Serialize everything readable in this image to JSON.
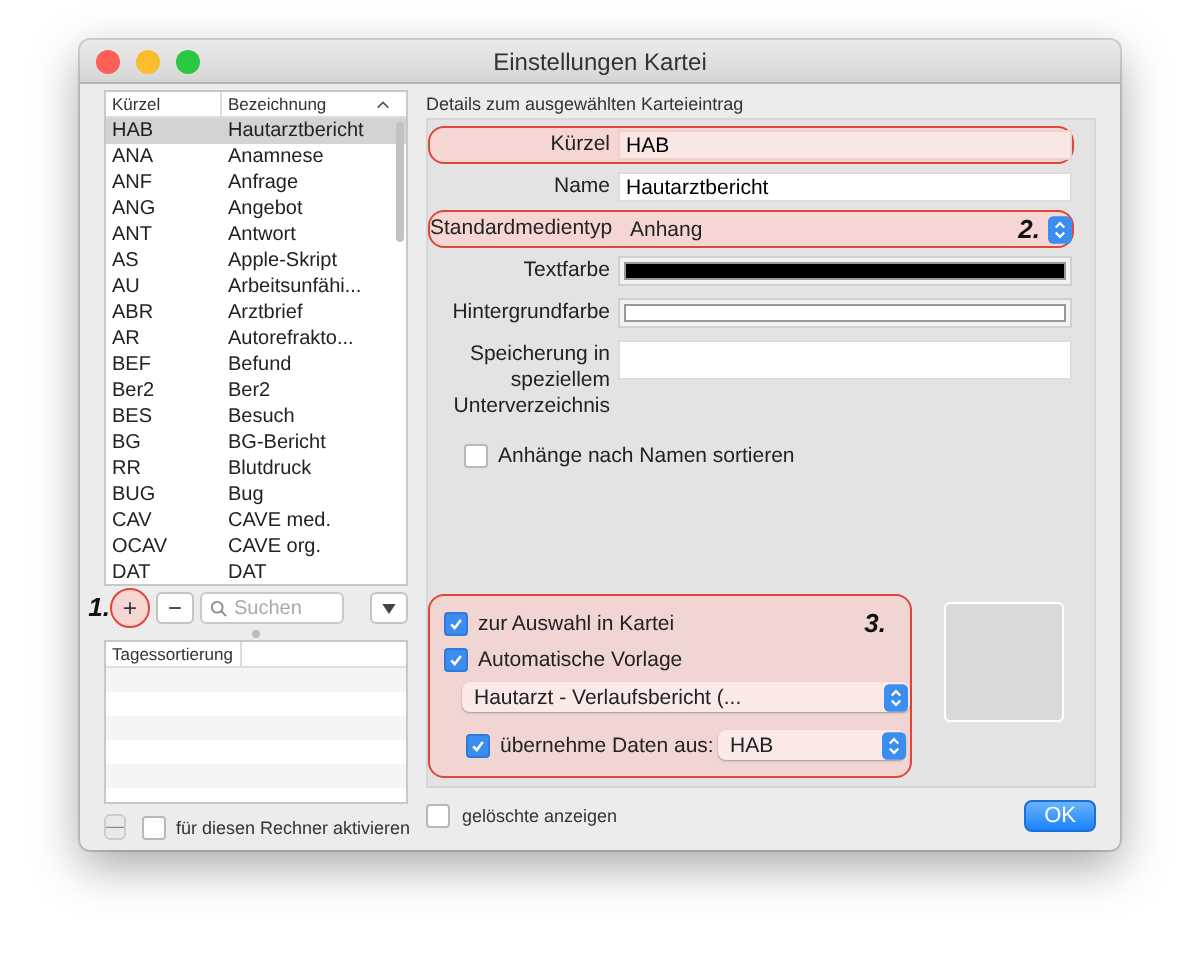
{
  "window": {
    "title": "Einstellungen Kartei"
  },
  "list": {
    "columns": [
      "Kürzel",
      "Bezeichnung"
    ],
    "rows": [
      {
        "code": "HAB",
        "name": "Hautarztbericht",
        "selected": true
      },
      {
        "code": "ANA",
        "name": "Anamnese",
        "selected": false
      },
      {
        "code": "ANF",
        "name": "Anfrage",
        "selected": false
      },
      {
        "code": "ANG",
        "name": "Angebot",
        "selected": false
      },
      {
        "code": "ANT",
        "name": "Antwort",
        "selected": false
      },
      {
        "code": "AS",
        "name": "Apple-Skript",
        "selected": false
      },
      {
        "code": "AU",
        "name": "Arbeitsunfähi...",
        "selected": false
      },
      {
        "code": "ABR",
        "name": "Arztbrief",
        "selected": false
      },
      {
        "code": "AR",
        "name": "Autorefrakto...",
        "selected": false
      },
      {
        "code": "BEF",
        "name": "Befund",
        "selected": false
      },
      {
        "code": "Ber2",
        "name": "Ber2",
        "selected": false
      },
      {
        "code": "BES",
        "name": "Besuch",
        "selected": false
      },
      {
        "code": "BG",
        "name": "BG-Bericht",
        "selected": false
      },
      {
        "code": "RR",
        "name": "Blutdruck",
        "selected": false
      },
      {
        "code": "BUG",
        "name": "Bug",
        "selected": false
      },
      {
        "code": "CAV",
        "name": "CAVE med.",
        "selected": false
      },
      {
        "code": "OCAV",
        "name": "CAVE org.",
        "selected": false
      },
      {
        "code": "DAT",
        "name": "DAT",
        "selected": false
      }
    ]
  },
  "toolbar": {
    "add": {
      "label": "+",
      "highlighted": true,
      "annotation": "1."
    },
    "remove": {
      "label": "−"
    },
    "search": {
      "placeholder": "Suchen"
    }
  },
  "day_sort": {
    "columns": [
      "Tagessortierung"
    ]
  },
  "machine": {
    "remove": {
      "label": "—",
      "disabled": true
    },
    "activate": {
      "label": "für diesen Rechner aktivieren",
      "checked": false
    }
  },
  "details": {
    "heading": "Details zum ausgewählten Karteieintrag",
    "fields": [
      {
        "kind": "text",
        "label": "Kürzel",
        "value": "HAB",
        "highlighted": true
      },
      {
        "kind": "text",
        "label": "Name",
        "value": "Hautarztbericht",
        "highlighted": false
      },
      {
        "kind": "select",
        "label": "Standardmedientyp",
        "value": "Anhang",
        "highlighted": true,
        "annotation": "2."
      },
      {
        "kind": "color",
        "label": "Textfarbe",
        "color": "#000000",
        "highlighted": false
      },
      {
        "kind": "color",
        "label": "Hintergrundfarbe",
        "color": "#ffffff",
        "highlighted": false
      },
      {
        "kind": "text",
        "label": "Speicherung in speziellem Unterverzeichnis",
        "highlighted": false
      }
    ],
    "sort_attachments": {
      "label": "Anhänge nach Namen sortieren",
      "checked": false
    }
  },
  "options": {
    "highlighted": true,
    "annotation": "3.",
    "selection": {
      "label": "zur Auswahl in Kartei",
      "checked": true
    },
    "auto_template": {
      "label": "Automatische Vorlage",
      "checked": true,
      "template": "Hautarzt - Verlaufsbericht (..."
    },
    "take_data": {
      "label": "übernehme Daten aus:",
      "checked": true,
      "source": "HAB"
    }
  },
  "show_deleted": {
    "label": "gelöschte anzeigen",
    "checked": false
  },
  "ok_button": "OK"
}
